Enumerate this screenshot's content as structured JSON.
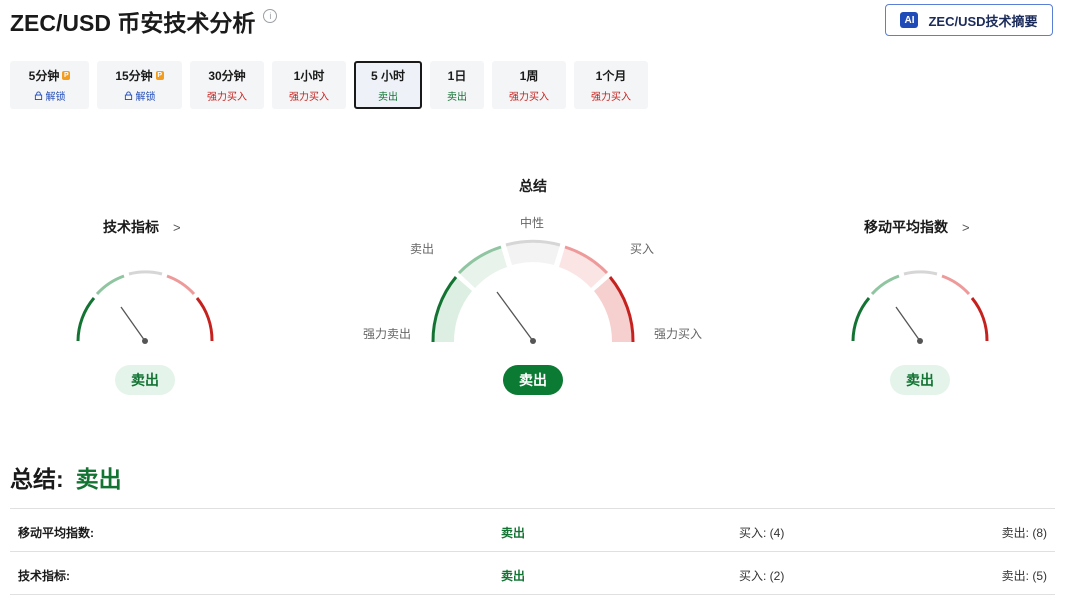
{
  "header": {
    "title": "ZEC/USD 币安技术分析",
    "ai_button": "ZEC/USD技术摘要",
    "ai_badge": "AI"
  },
  "tabs": [
    {
      "label": "5分钟",
      "status": "解锁",
      "locked": true
    },
    {
      "label": "15分钟",
      "status": "解锁",
      "locked": true
    },
    {
      "label": "30分钟",
      "status": "强力买入"
    },
    {
      "label": "1小时",
      "status": "强力买入"
    },
    {
      "label": "5 小时",
      "status": "卖出",
      "active": true
    },
    {
      "label": "1日",
      "status": "卖出"
    },
    {
      "label": "1周",
      "status": "强力买入"
    },
    {
      "label": "1个月",
      "status": "强力买入"
    }
  ],
  "gauges": {
    "tech": {
      "title": "技术指标",
      "result": "卖出"
    },
    "summary": {
      "title": "总结",
      "result": "卖出",
      "labels": {
        "neutral": "中性",
        "sell": "卖出",
        "buy": "买入",
        "strong_sell": "强力卖出",
        "strong_buy": "强力买入"
      }
    },
    "ma": {
      "title": "移动平均指数",
      "result": "卖出"
    }
  },
  "summary": {
    "label": "总结:",
    "value": "卖出",
    "rows": [
      {
        "name": "移动平均指数:",
        "signal": "卖出",
        "buy": "买入: (4)",
        "sell": "卖出: (8)"
      },
      {
        "name": "技术指标:",
        "signal": "卖出",
        "buy": "买入: (2)",
        "sell": "卖出: (5)"
      }
    ]
  },
  "colors": {
    "strong_sell": "#137333",
    "sell": "#8fc5a0",
    "neutral": "#d6d6d6",
    "buy": "#ee9a9a",
    "strong_buy": "#c5221f",
    "needle": "#555555"
  }
}
